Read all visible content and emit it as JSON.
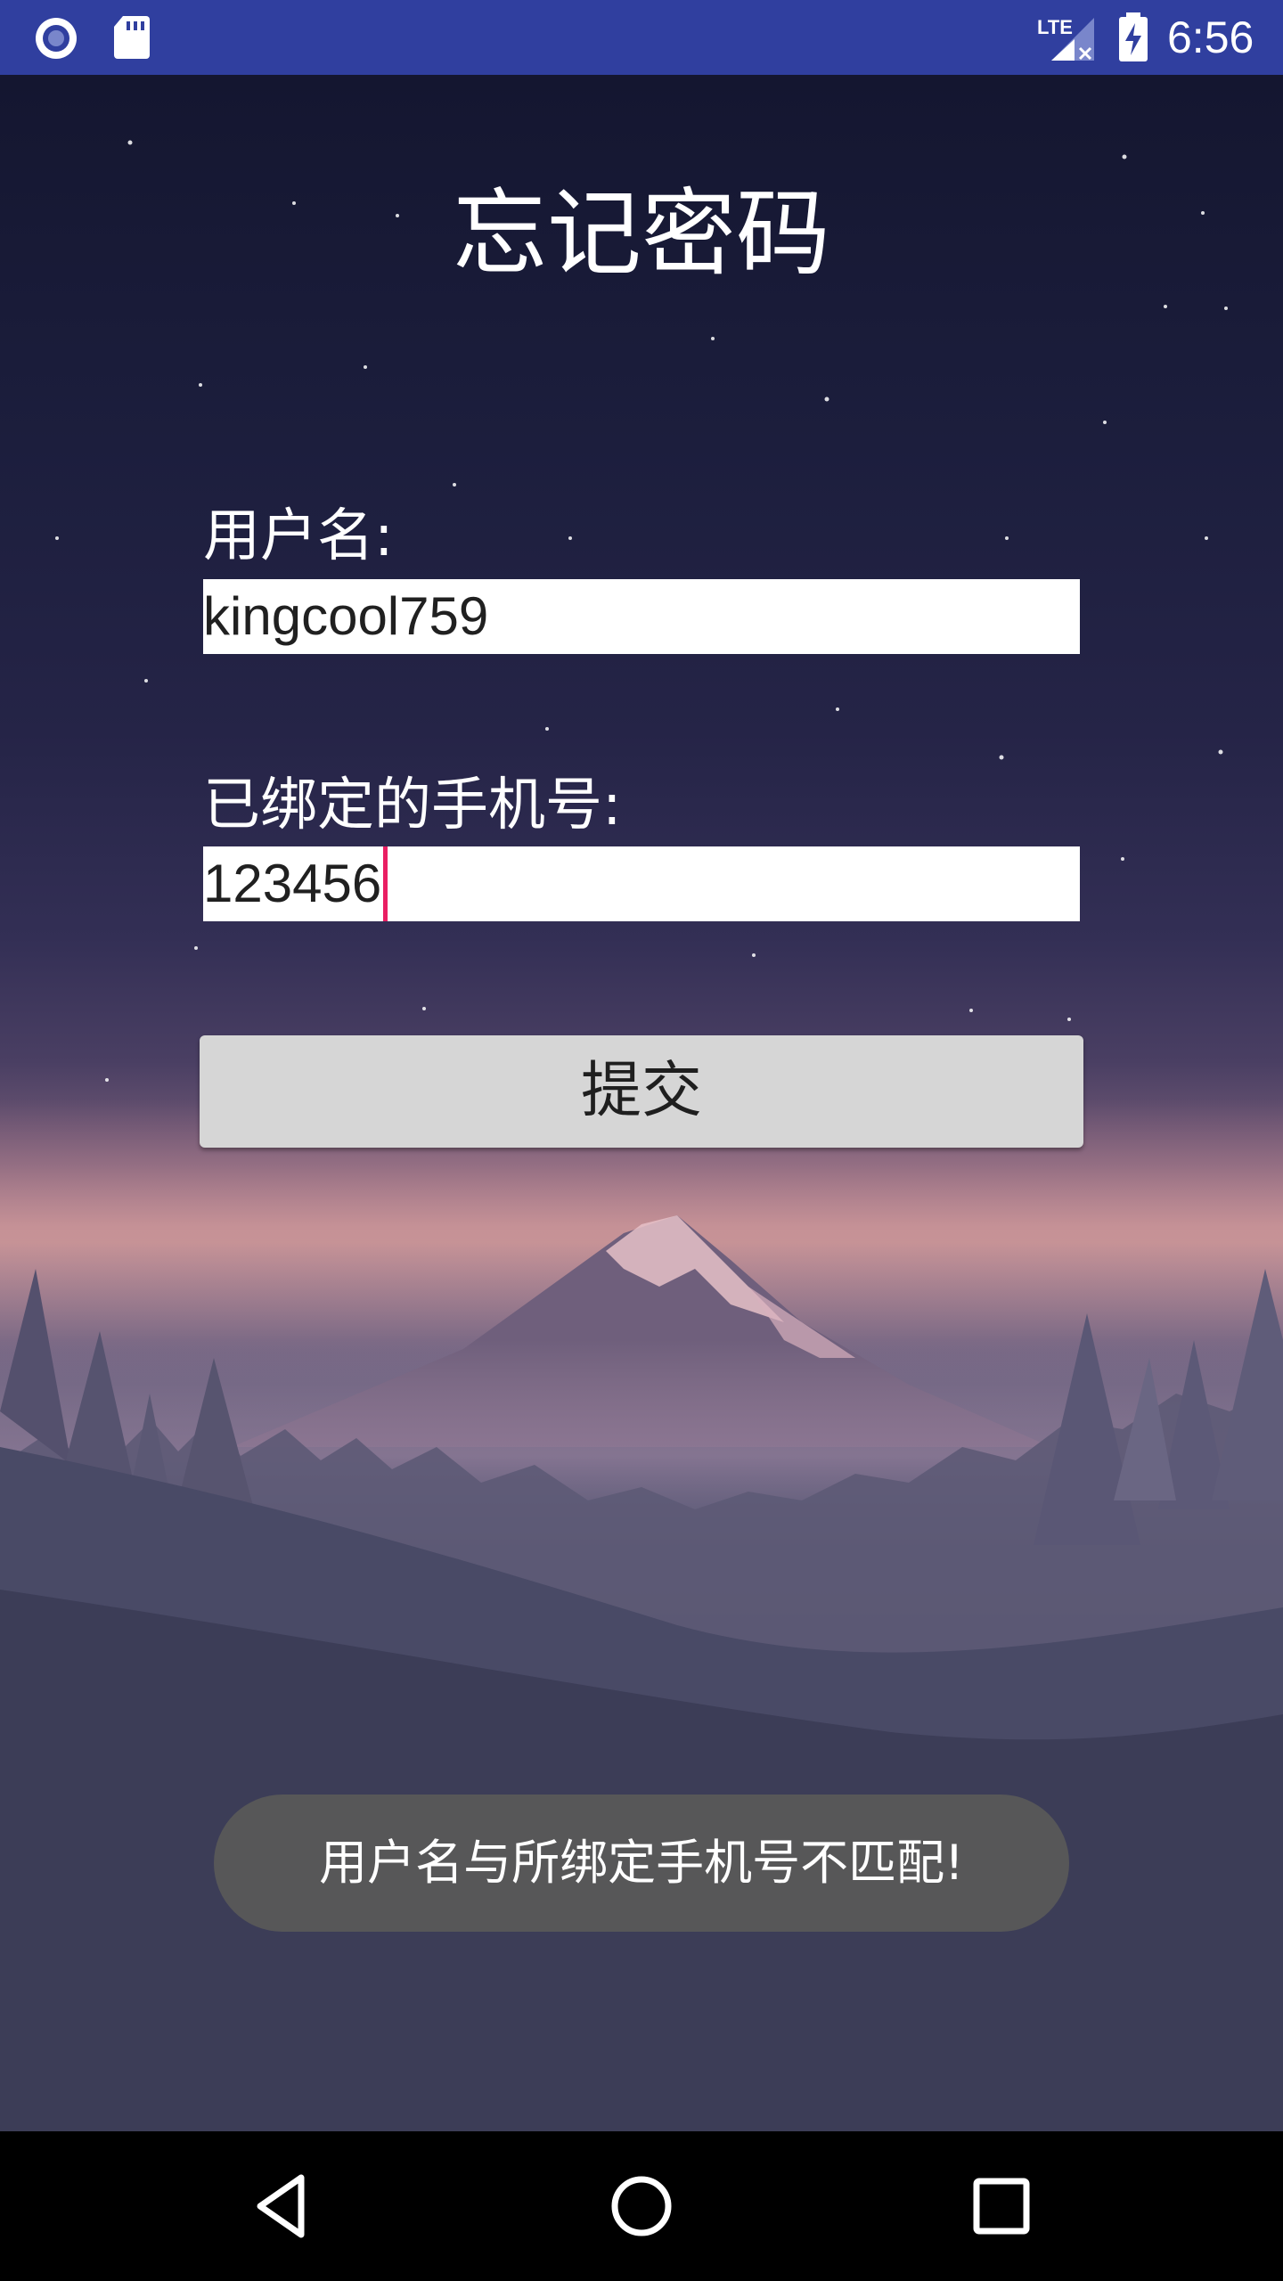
{
  "status_bar": {
    "time": "6:56",
    "network_label": "LTE",
    "icons": [
      "radio-icon",
      "sd-card-icon",
      "lte-signal-icon",
      "battery-charging-icon"
    ],
    "color": "#303f9f"
  },
  "page": {
    "title": "忘记密码"
  },
  "form": {
    "username_label": "用户名:",
    "username_value": "kingcool759",
    "phone_label": "已绑定的手机号:",
    "phone_value": "123456",
    "submit_label": "提交"
  },
  "toast": {
    "message": "用户名与所绑定手机号不匹配!"
  },
  "nav_bar": {
    "icons": [
      "back-icon",
      "home-icon",
      "recents-icon"
    ]
  },
  "colors": {
    "accent_caret": "#e91e63",
    "button_bg": "#d6d6d6",
    "toast_bg": "#585858"
  }
}
